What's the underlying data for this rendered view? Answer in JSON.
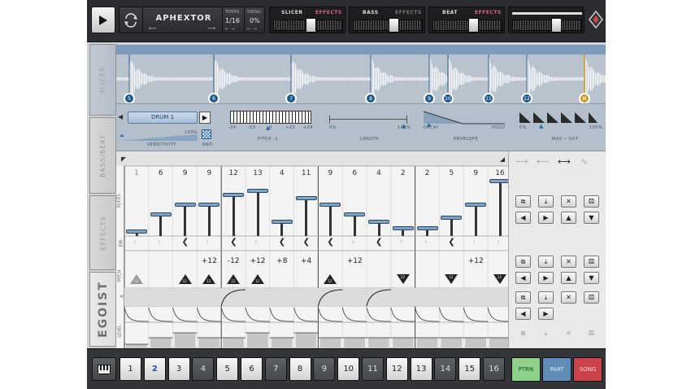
{
  "topbar": {
    "song_name": "APHEXTOR",
    "tempo_label": "TEMPO",
    "tempo_value": "1/16",
    "swing_label": "SWING",
    "swing_value": "0%",
    "panels": [
      {
        "title": "SLICER",
        "effects": "EFFECTS"
      },
      {
        "title": "BASS",
        "effects": "EFFECTS"
      },
      {
        "title": "BEAT",
        "effects": "EFFECTS"
      }
    ]
  },
  "side_tabs": [
    "SLICER",
    "BASS/BEAT",
    "EFFECTS",
    "EGOIST"
  ],
  "slicer": {
    "markers": [
      "5",
      "6",
      "7",
      "8",
      "9",
      "10",
      "11",
      "12",
      "M"
    ],
    "drum_name": "DRUM 1",
    "sensitivity_label": "SENSITIVITY",
    "sensitivity_value": "100%",
    "rnd_label": "RND",
    "pitch_ticks": [
      "-24",
      "-12",
      "0",
      "+12",
      "+24"
    ],
    "pitch_label": "PITCH",
    "pitch_value": "-1",
    "length_ticks": [
      "0%",
      "100%"
    ],
    "length_label": "LENGTH",
    "envelope_ticks": [
      "DECAY",
      "HOLD"
    ],
    "envelope_label": "ENVELOPE",
    "maxout_ticks": [
      "0%",
      "100%"
    ],
    "maxout_label": "MAX • OUT"
  },
  "grid": {
    "row_labels": [
      "SLICES",
      "DIR",
      "PITCH",
      "A",
      "LEVEL"
    ],
    "steps": [
      {
        "num": "1",
        "slice": 1,
        "dir": "dim",
        "pitch": "",
        "tri": "dimup"
      },
      {
        "num": "6",
        "slice": 6,
        "dir": "dim",
        "pitch": "",
        "tri": ""
      },
      {
        "num": "9",
        "slice": 9,
        "dir": "left",
        "pitch": "",
        "tri": "up12"
      },
      {
        "num": "9",
        "slice": 9,
        "dir": "dim",
        "pitch": "+12",
        "tri": "up12"
      },
      {
        "num": "12",
        "slice": 12,
        "dir": "left",
        "pitch": "-12",
        "tri": "up12"
      },
      {
        "num": "13",
        "slice": 13,
        "dir": "dim",
        "pitch": "+12",
        "tri": "up12"
      },
      {
        "num": "4",
        "slice": 4,
        "dir": "left",
        "pitch": "+8",
        "tri": ""
      },
      {
        "num": "11",
        "slice": 11,
        "dir": "left",
        "pitch": "+4",
        "tri": ""
      },
      {
        "num": "9",
        "slice": 9,
        "dir": "left",
        "pitch": "",
        "tri": "up12"
      },
      {
        "num": "6",
        "slice": 6,
        "dir": "dim",
        "pitch": "+12",
        "tri": ""
      },
      {
        "num": "4",
        "slice": 4,
        "dir": "left",
        "pitch": "",
        "tri": ""
      },
      {
        "num": "2",
        "slice": 2,
        "dir": "dim",
        "pitch": "",
        "tri": "down12"
      },
      {
        "num": "2",
        "slice": 2,
        "dir": "dim",
        "pitch": "",
        "tri": ""
      },
      {
        "num": "5",
        "slice": 5,
        "dir": "left",
        "pitch": "",
        "tri": "down12"
      },
      {
        "num": "9",
        "slice": 9,
        "dir": "dim",
        "pitch": "+12",
        "tri": ""
      },
      {
        "num": "16",
        "slice": 16,
        "dir": "dim",
        "pitch": "",
        "tri": "down12"
      }
    ],
    "tri_value": "12"
  },
  "bottombar": {
    "patterns": [
      "1",
      "2",
      "3",
      "4",
      "5",
      "6",
      "7",
      "8",
      "9",
      "10",
      "11",
      "12",
      "13",
      "14",
      "15",
      "16"
    ],
    "selected_pattern": "2",
    "modes": [
      {
        "label": "PTRN",
        "color": "#8fd08a"
      },
      {
        "label": "PART",
        "color": "#5f8db8"
      },
      {
        "label": "SONG",
        "color": "#c9434b"
      }
    ]
  }
}
